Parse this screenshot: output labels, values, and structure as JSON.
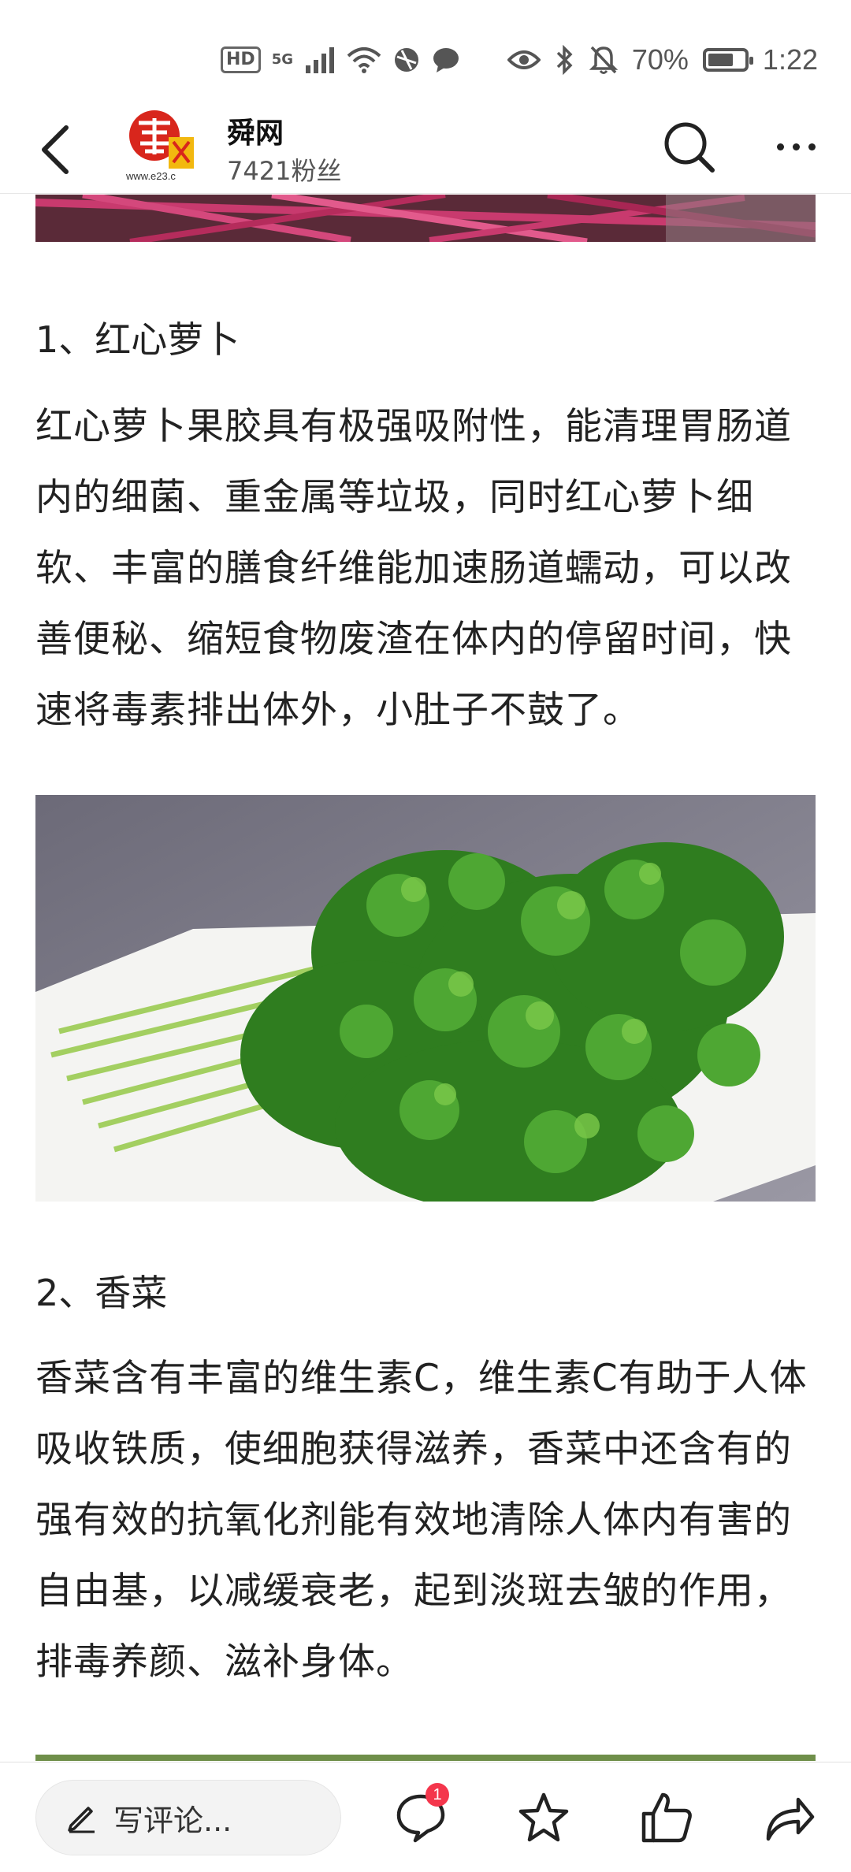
{
  "status_bar": {
    "hd": "HD",
    "network": "5G",
    "battery_percent": "70%",
    "battery_level": 0.7,
    "time": "1:22"
  },
  "header": {
    "account_name": "舜网",
    "followers": "7421粉丝",
    "logo_text": "舜网",
    "logo_url_text": "www.e23.c"
  },
  "article": {
    "section1_title": "1、红心萝卜",
    "section1_body": "红心萝卜果胶具有极强吸附性，能清理胃肠道内的细菌、重金属等垃圾，同时红心萝卜细软、丰富的膳食纤维能加速肠道蠕动，可以改善便秘、缩短食物废渣在体内的停留时间，快速将毒素排出体外，小肚子不鼓了。",
    "section2_title": "2、香菜",
    "section2_body": "香菜含有丰富的维生素C，维生素C有助于人体吸收铁质，使细胞获得滋养，香菜中还含有的强有效的抗氧化剂能有效地清除人体内有害的自由基，以减缓衰老，起到淡斑去皱的作用，排毒养颜、滋补身体。"
  },
  "bottom_bar": {
    "comment_placeholder": "写评论...",
    "comment_count": "1"
  },
  "colors": {
    "badge": "#f4364c",
    "logo_red": "#d8261c",
    "logo_yellow": "#f2b80f"
  }
}
